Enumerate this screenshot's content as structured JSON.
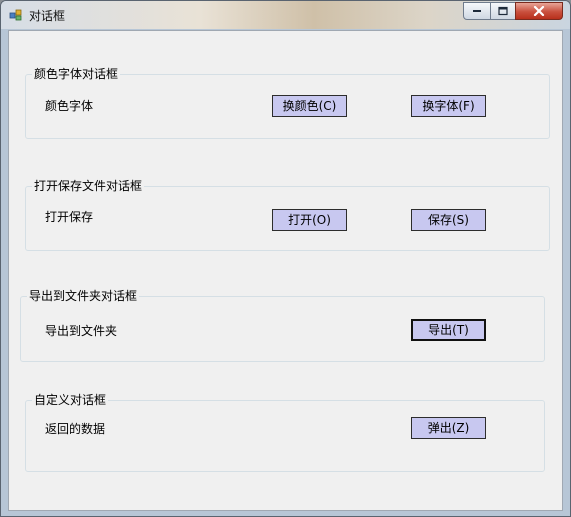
{
  "window": {
    "title": "对话框"
  },
  "groups": [
    {
      "title": "颜色字体对话框",
      "label": "颜色字体",
      "buttons": [
        "换颜色(C)",
        "换字体(F)"
      ]
    },
    {
      "title": "打开保存文件对话框",
      "label": "打开保存",
      "buttons": [
        "打开(O)",
        "保存(S)"
      ]
    },
    {
      "title": "导出到文件夹对话框",
      "label": "导出到文件夹",
      "buttons": [
        "导出(T)"
      ]
    },
    {
      "title": "自定义对话框",
      "label": "返回的数据",
      "buttons": [
        "弹出(Z)"
      ]
    }
  ],
  "colors": {
    "button_face": "#c8c8f0",
    "client_bg": "#f0f0f0"
  },
  "icons": [
    "app-icon",
    "minimize-icon",
    "maximize-icon",
    "close-icon"
  ]
}
